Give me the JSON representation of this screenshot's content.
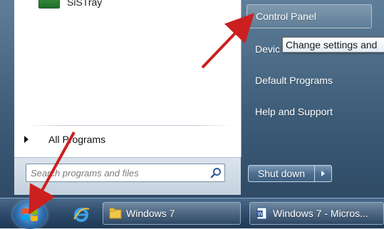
{
  "left_pane": {
    "program_top_label": "SiSTray",
    "all_programs_label": "All Programs",
    "search_placeholder": "Search programs and files"
  },
  "right_pane": {
    "items": [
      {
        "label": "Control Panel"
      },
      {
        "label": "Devic"
      },
      {
        "label": "Default Programs"
      },
      {
        "label": "Help and Support"
      }
    ],
    "shutdown_label": "Shut down"
  },
  "tooltip": {
    "text": "Change settings and"
  },
  "taskbar": {
    "items": [
      {
        "label": "Windows 7",
        "icon": "folder-icon"
      },
      {
        "label": "Windows 7 - Micros...",
        "icon": "word-document-icon"
      }
    ]
  },
  "colors": {
    "arrow": "#cc1f1f",
    "menu_right": "#3f5e7a",
    "taskbar": "#2d4b6b"
  }
}
